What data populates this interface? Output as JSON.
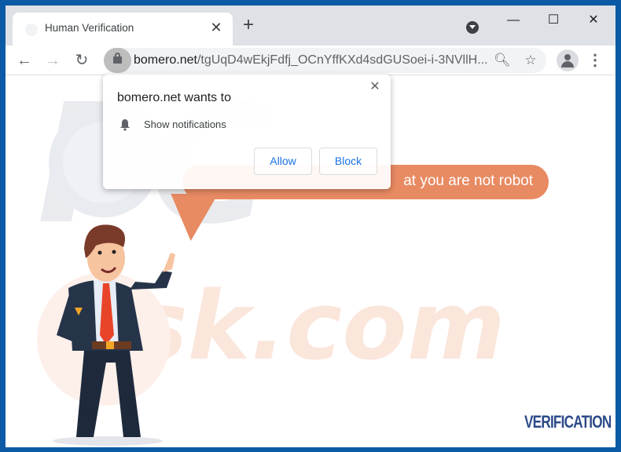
{
  "browser": {
    "tab": {
      "title": "Human Verification",
      "close_glyph": "✕"
    },
    "new_tab_glyph": "+",
    "window_controls": {
      "minimize": "—",
      "maximize": "☐",
      "close": "✕"
    },
    "nav": {
      "back": "←",
      "forward": "→",
      "reload": "↻"
    },
    "address": {
      "domain": "bomero.net",
      "path": "/tgUqD4wEkjFdfj_OCnYffKXd4sdGUSoei-i-3NVllH..."
    },
    "omnibox_icons": {
      "zoom": "🔍︎",
      "star": "☆"
    },
    "menu_glyph": "⋮"
  },
  "permission_popup": {
    "title": "bomero.net wants to",
    "permission": "Show notifications",
    "close_glyph": "✕",
    "allow_label": "Allow",
    "block_label": "Block"
  },
  "page": {
    "bubble_text": "at you are not robot",
    "footer_label": "VERIFICATION",
    "watermark_top": "PC",
    "watermark_bottom": "risk.com"
  },
  "colors": {
    "accent": "#e88a62",
    "button_text": "#1a73e8",
    "footer_text": "#2d4b8a",
    "window_border": "#0b5aa6"
  }
}
